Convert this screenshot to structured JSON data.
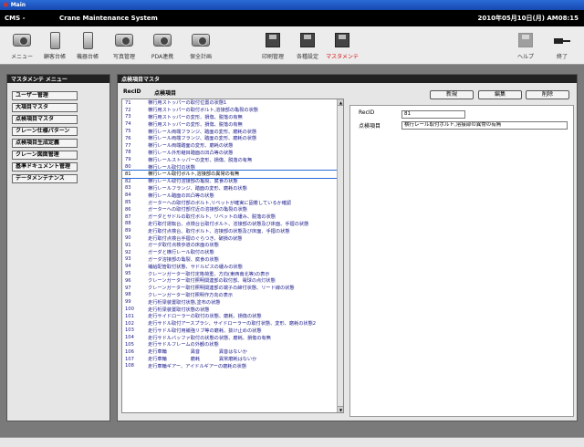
{
  "window": {
    "title": "Main"
  },
  "header": {
    "code": "CMS -",
    "system_name": "Crane Maintenance System",
    "datetime": "2010年05月10日(月) AM08:15"
  },
  "toolbar": {
    "left": [
      {
        "label": "メニュー",
        "icon": "camera-icon"
      },
      {
        "label": "顧客台帳",
        "icon": "phone-icon"
      },
      {
        "label": "機器台帳",
        "icon": "phone-icon"
      },
      {
        "label": "写真管理",
        "icon": "camera-icon"
      },
      {
        "label": "PDA連携",
        "icon": "camera-icon"
      },
      {
        "label": "保全計画",
        "icon": "camera-icon"
      }
    ],
    "center": [
      {
        "label": "印刷管理",
        "icon": "disk-icon"
      },
      {
        "label": "各種設定",
        "icon": "disk-icon"
      },
      {
        "label": "マスタメンテ",
        "icon": "disk-icon"
      }
    ],
    "right": [
      {
        "label": "ヘルプ",
        "icon": "disk-icon"
      },
      {
        "label": "終了",
        "icon": "plug-icon"
      }
    ]
  },
  "menu": {
    "title": "マスタメンテ メニュー",
    "items": [
      "ユーザー管理",
      "大項目マスタ",
      "点検項目マスタ",
      "クレーン仕様パターン",
      "点検項目生成定義",
      "クレーン図面管理",
      "基準ドキュメント管理",
      "データメンテナンス"
    ]
  },
  "main": {
    "title": "点検項目マスタ",
    "col_recid": "RecID",
    "col_name": "点検項目",
    "buttons": {
      "new": "新規",
      "edit": "編集",
      "delete": "削除"
    },
    "rows": [
      {
        "id": "71",
        "name": "横行用ストッパーの取付位置の状態1"
      },
      {
        "id": "72",
        "name": "横行用ストッパーの取付ボルト,溶接部の亀裂の状態"
      },
      {
        "id": "73",
        "name": "横行用ストッパーの変形、損傷、脱落の有無"
      },
      {
        "id": "74",
        "name": "横行用ストッパーの変形、損傷、脱落の有無"
      },
      {
        "id": "75",
        "name": "横行レール両端フランジ、踏面の変形、磨耗の状態"
      },
      {
        "id": "76",
        "name": "横行レール両端フランジ、踏面の変形、磨耗の状態"
      },
      {
        "id": "77",
        "name": "横行レール両端踏面の変形、磨耗の状態"
      },
      {
        "id": "78",
        "name": "横行レール外形継目踏面の凹凸等の状態"
      },
      {
        "id": "79",
        "name": "横行レールストッパーの変形、損傷、脱落の有無"
      },
      {
        "id": "80",
        "name": "横行レール取付の状態"
      },
      {
        "id": "81",
        "name": "横行レール取付ボルト,溶接部の異常の有無"
      },
      {
        "id": "82",
        "name": "横行レール取付溶接部の亀裂、腐食の状態"
      },
      {
        "id": "83",
        "name": "横行レールフランジ、踏面の変形、磨耗の状態"
      },
      {
        "id": "84",
        "name": "横行レール踏面の凹凸等の状態"
      },
      {
        "id": "85",
        "name": "ガーターへの取付部のボルト,リベットが確実に固着しているか確認"
      },
      {
        "id": "86",
        "name": "ガーターへの取付部付近の溶接部の亀裂の状態"
      },
      {
        "id": "87",
        "name": "ガーダとサドルの取付ボルト、リベットの緩み、脱落の状態"
      },
      {
        "id": "88",
        "name": "走行取付運転台、点検台台取付ボルト、溶接部の状態及び床面、手摺の状態"
      },
      {
        "id": "89",
        "name": "走行取付点検台、取付ボルト、溶接部の状態及び床面、手摺の状態"
      },
      {
        "id": "90",
        "name": "走行取付点検台手摺のぐらつき、破損の状態"
      },
      {
        "id": "91",
        "name": "ガーダ取付点検歩道の床面の状態"
      },
      {
        "id": "92",
        "name": "ガーダと横行レール取付の状態"
      },
      {
        "id": "93",
        "name": "ガーダ溶接部の亀裂、腐食の状態"
      },
      {
        "id": "94",
        "name": "補給配管取付状態、サドルピスの緩みの状態"
      },
      {
        "id": "95",
        "name": "クレーンガーター取付定格荷重、方向(東西南北等)の表示"
      },
      {
        "id": "96",
        "name": "クレーンガーター取付照明関連部の取付部、電球の点灯状態"
      },
      {
        "id": "97",
        "name": "クレーンガーター取付照明関連部の端子の締付状態、リード線の状態"
      },
      {
        "id": "98",
        "name": "クレーンガーター取付照明作方向の表示"
      },
      {
        "id": "99",
        "name": "走行桁梁装置取付状態,塗布の状態"
      },
      {
        "id": "100",
        "name": "走行桁梁装置取付状態の状態"
      },
      {
        "id": "101",
        "name": "走行サイドローラーの取付の状態、磨耗、損傷の状態"
      },
      {
        "id": "102",
        "name": "走行サドル取付アースプラシ、サイドローラーの取付状態、変形、磨耗の状態2"
      },
      {
        "id": "103",
        "name": "走行サドル取付用補強リブ等の磨耗、抜け止めの状態"
      },
      {
        "id": "104",
        "name": "走行サドルバッファ取付の状態の状態、磨耗、損傷の有無"
      },
      {
        "id": "105",
        "name": "走行サドルフレームの外観の状態"
      },
      {
        "id": "106",
        "name": "走行車輪　　　　　異音　　　　異音はないか"
      },
      {
        "id": "107",
        "name": "走行車輪　　　　　磨耗　　　　異常磨耗はないか"
      },
      {
        "id": "108",
        "name": "走行車輪ギアー、アイドルギアーの磨耗の状態"
      }
    ],
    "detail": {
      "recid_label": "RecID",
      "recid_value": "81",
      "item_label": "点検項目",
      "item_value": "横行レール取付ボルト,溶接部の異常の有無"
    }
  },
  "colors": {
    "header_bg": "#000000",
    "titlebar_bg": "#1848b0",
    "active_label": "#d01010",
    "list_text": "#1a1a8a"
  }
}
